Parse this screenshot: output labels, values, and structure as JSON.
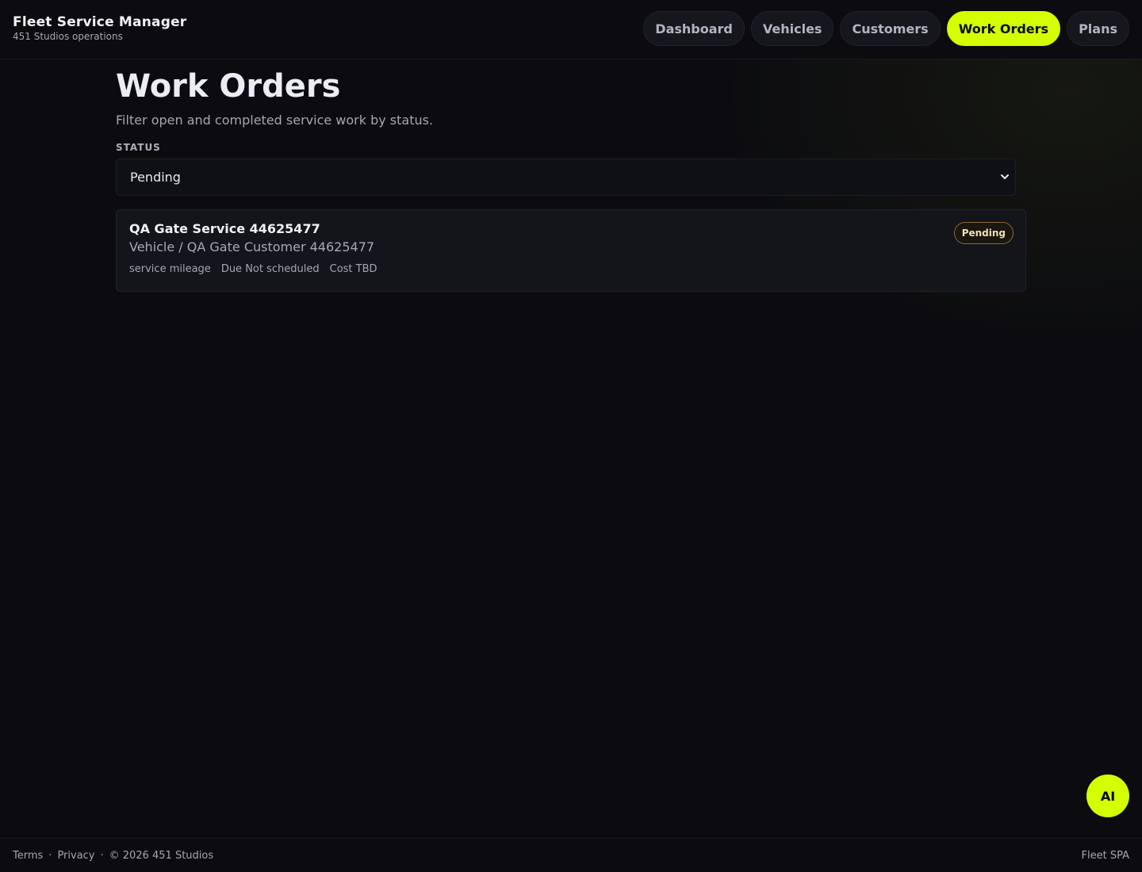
{
  "brand": {
    "title": "Fleet Service Manager",
    "subtitle": "451 Studios operations"
  },
  "nav": {
    "items": [
      "Dashboard",
      "Vehicles",
      "Customers",
      "Work Orders",
      "Plans"
    ],
    "active": "Work Orders"
  },
  "page": {
    "title": "Work Orders",
    "subtitle": "Filter open and completed service work by status."
  },
  "filter": {
    "label": "STATUS",
    "selected": "Pending"
  },
  "work_orders": [
    {
      "title": "QA Gate Service 44625477",
      "subtitle": "Vehicle / QA Gate Customer 44625477",
      "type": "service mileage",
      "due": "Due Not scheduled",
      "cost": "Cost TBD",
      "status": "Pending"
    }
  ],
  "fab": {
    "label": "AI"
  },
  "footer": {
    "terms": "Terms",
    "sep": "·",
    "privacy": "Privacy",
    "copyright": "© 2026 451 Studios",
    "right": "Fleet SPA"
  },
  "colors": {
    "accent": "#d4ff00",
    "background": "#0b0b10",
    "pending_badge_border": "#8a6a30"
  }
}
